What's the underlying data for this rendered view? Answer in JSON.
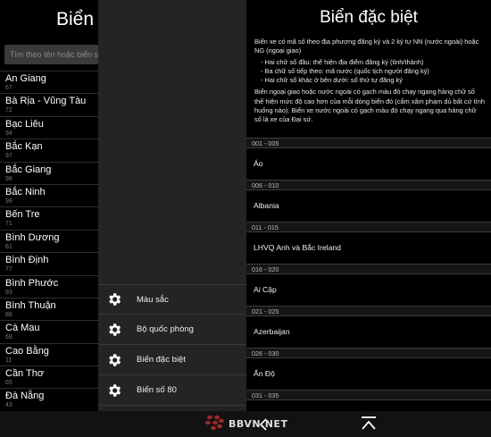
{
  "left": {
    "title": "Biển",
    "search_placeholder": "Tìm theo tên hoặc biển số",
    "provinces": [
      {
        "name": "An Giang",
        "code": "67"
      },
      {
        "name": "Bà Rịa - Vũng Tàu",
        "code": "72"
      },
      {
        "name": "Bạc Liêu",
        "code": "94"
      },
      {
        "name": "Bắc Kạn",
        "code": "97"
      },
      {
        "name": "Bắc Giang",
        "code": "98"
      },
      {
        "name": "Bắc Ninh",
        "code": "99"
      },
      {
        "name": "Bến Tre",
        "code": "71"
      },
      {
        "name": "Bình Dương",
        "code": "61"
      },
      {
        "name": "Bình Định",
        "code": "77"
      },
      {
        "name": "Bình Phước",
        "code": "93"
      },
      {
        "name": "Bình Thuận",
        "code": "86"
      },
      {
        "name": "Cà Mau",
        "code": "69"
      },
      {
        "name": "Cao Bằng",
        "code": "11"
      },
      {
        "name": "Cần Thơ",
        "code": "65"
      },
      {
        "name": "Đà Nẵng",
        "code": "43"
      }
    ]
  },
  "menu": {
    "items": [
      {
        "label": "Màu sắc",
        "icon": "gear-icon"
      },
      {
        "label": "Bộ quốc phòng",
        "icon": "gear-icon"
      },
      {
        "label": "Biển đặc biệt",
        "icon": "gear-icon"
      },
      {
        "label": "Biển số 80",
        "icon": "gear-icon"
      }
    ]
  },
  "content": {
    "title": "Biển đặc biệt",
    "intro_p1": "Biển xe có mã số theo địa phương đăng ký và 2 ký tự NN (nước ngoài) hoặc NG (ngoại giao)",
    "bullets": [
      "- Hai chữ số đầu: thể hiện địa điểm đăng ký (tỉnh/thành)",
      "- Ba chữ số tiếp theo: mã nước (quốc tịch người đăng ký)",
      "- Hai chữ số khác ở bên dưới: số thứ tự đăng ký"
    ],
    "intro_p2": "Biển ngoại giao hoặc nước ngoài có gạch màu đỏ chạy ngang hàng chữ số thể hiện mức độ cao hơn của mỗi dòng biển đó (cấm xâm phạm dù bất cứ tình huống nào). Biển xe nước ngoài có gạch màu đỏ chạy ngang qua hàng chữ số là xe của Đại sứ.",
    "sections": [
      {
        "range": "001 - 005",
        "country": "Áo"
      },
      {
        "range": "006 - 010",
        "country": "Albania"
      },
      {
        "range": "011 - 015",
        "country": "LHVQ Anh và Bắc Ireland"
      },
      {
        "range": "016 - 020",
        "country": "Ai Cập"
      },
      {
        "range": "021 - 025",
        "country": "Azerbaijan"
      },
      {
        "range": "026 - 030",
        "country": "Ấn Độ"
      },
      {
        "range": "031 - 035",
        "country": ""
      }
    ]
  },
  "bottom": {
    "back_icon": "back-chevron-icon",
    "up_icon": "scroll-top-icon",
    "watermark_text": "BBVN.NET"
  },
  "colors": {
    "background": "#000000",
    "menu_background": "#242424",
    "divider": "#3a3a3a",
    "secondary_text": "#777777",
    "section_header_bg": "#161616"
  }
}
